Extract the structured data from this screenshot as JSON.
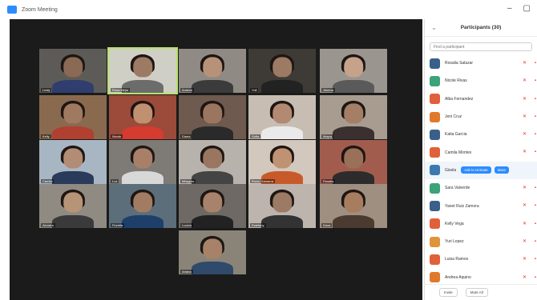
{
  "window": {
    "title": "Zoom Meeting",
    "minimize": "–",
    "maximize": "▢"
  },
  "gallery": {
    "tiles": [
      {
        "name": "Lesly",
        "bg": "#5d5b57",
        "face": "#8a6a55",
        "body": "#2f3e6e"
      },
      {
        "name": "Rosa Mejia",
        "bg": "#cfcfc6",
        "face": "#9c7a64",
        "body": "#6c6c6c"
      },
      {
        "name": "Andrea",
        "bg": "#8f8a84",
        "face": "#b89278",
        "body": "#3b3b3b"
      },
      {
        "name": "Yuli",
        "bg": "#3e3a36",
        "face": "#9c7a64",
        "body": "#222222"
      },
      {
        "name": "Jimena",
        "bg": "#9a958f",
        "face": "#c6a28a",
        "body": "#5a5a5a"
      },
      {
        "name": "Kelly",
        "bg": "#8a6a4f",
        "face": "#a07a60",
        "body": "#b04030"
      },
      {
        "name": "Nicole",
        "bg": "#9c4a3a",
        "face": "#c09070",
        "body": "#d63b2f"
      },
      {
        "name": "Diana",
        "bg": "#6e5a4e",
        "face": "#9a7660",
        "body": "#2a2a2a"
      },
      {
        "name": "Sofia",
        "bg": "#c8bdb3",
        "face": "#b28a72",
        "body": "#eaeaea"
      },
      {
        "name": "Mayra",
        "bg": "#a89c90",
        "face": "#a57e66",
        "body": "#3a3030"
      },
      {
        "name": "Camila",
        "bg": "#a8b6c4",
        "face": "#b28c74",
        "body": "#2a3a5a"
      },
      {
        "name": "Luz",
        "bg": "#7e7a76",
        "face": "#a88068",
        "body": "#d8d8d8"
      },
      {
        "name": "Milagros",
        "bg": "#b7b2ab",
        "face": "#9a7660",
        "body": "#444444"
      },
      {
        "name": "Rocio Gamarra",
        "bg": "#d3c8bd",
        "face": "#c09274",
        "body": "#c85a2a"
      },
      {
        "name": "Rosalia",
        "bg": "#a25c4e",
        "face": "#9a7058",
        "body": "#2c2c2c"
      },
      {
        "name": "Alondra",
        "bg": "#8f8a82",
        "face": "#b69478",
        "body": "#3a3a3a"
      },
      {
        "name": "Fiorella",
        "bg": "#5b6e7a",
        "face": "#a27c62",
        "body": "#1e3f6a"
      },
      {
        "name": "Lucero",
        "bg": "#6e6964",
        "face": "#a8826a",
        "body": "#222222"
      },
      {
        "name": "Estefany",
        "bg": "#bdb5ad",
        "face": "#9c7a64",
        "body": "#333333"
      },
      {
        "name": "Kiara",
        "bg": "#9e8f80",
        "face": "#a87c5e",
        "body": "#4a3a30"
      },
      {
        "name": "Ariana",
        "bg": "#8a8478",
        "face": "#a88268",
        "body": "#2f4a6a"
      }
    ]
  },
  "participants": {
    "title": "Participants (30)",
    "search_placeholder": "Find a participant",
    "list": [
      {
        "name": "Rosalia Salazar",
        "color": "#3a5f8a"
      },
      {
        "name": "Nicole Rivas",
        "color": "#3aa37a"
      },
      {
        "name": "Alba Fernandez",
        "color": "#e0603a"
      },
      {
        "name": "Jeni Cruz",
        "color": "#e07a2a"
      },
      {
        "name": "Katia Garcia",
        "color": "#3a5f8a"
      },
      {
        "name": "Camila Montes",
        "color": "#e0603a"
      },
      {
        "name": "Gisela",
        "color": "#3a7ab0"
      },
      {
        "name": "Sara Valverde",
        "color": "#3aa37a"
      },
      {
        "name": "Yanet Ruiz Zamora",
        "color": "#3a5f8a"
      },
      {
        "name": "Kelly Vega",
        "color": "#e0603a"
      },
      {
        "name": "Yuri Lopez",
        "color": "#e0943a"
      },
      {
        "name": "Luisa Ramos",
        "color": "#e0603a"
      },
      {
        "name": "Andrea Aquino",
        "color": "#e07a2a"
      }
    ],
    "ask_unmute": "Ask to Unmute",
    "more": "More",
    "footer": {
      "invite": "Invite",
      "mute_all": "Mute All"
    },
    "mic_icon": "mic-muted-icon",
    "cam_icon": "camera-off-icon"
  }
}
